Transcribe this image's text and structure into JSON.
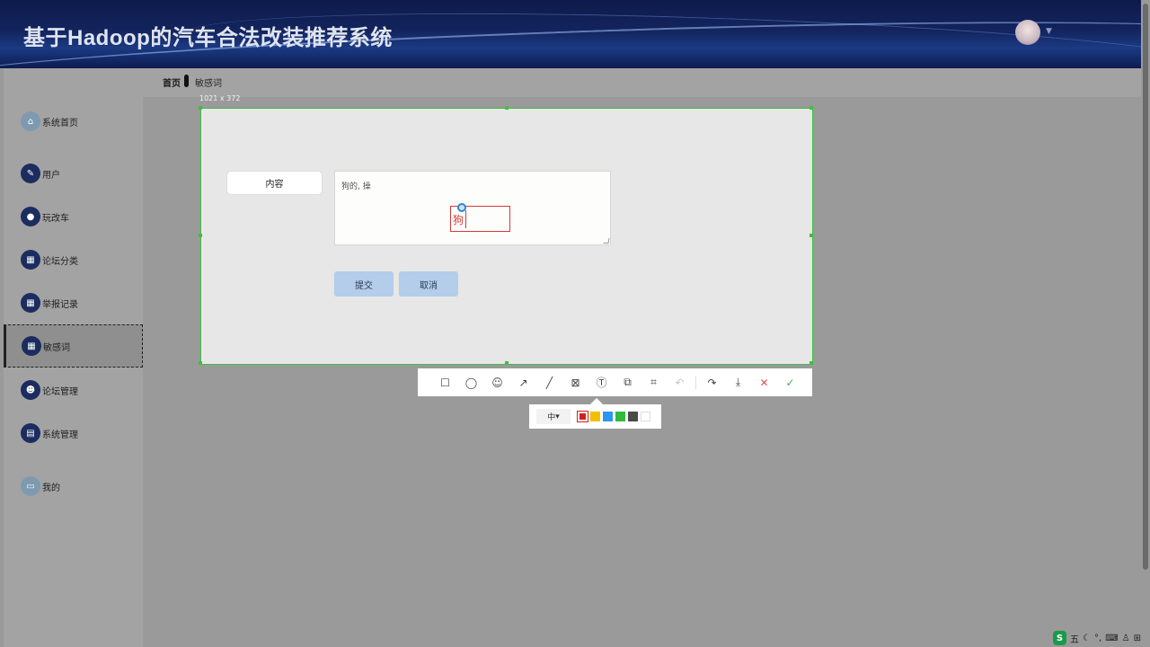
{
  "header": {
    "title": "基于Hadoop的汽车合法改装推荐系统"
  },
  "breadcrumb": {
    "home": "首页",
    "current": "敏感词"
  },
  "sidebar": {
    "items": [
      {
        "label": "系统首页",
        "icon": "home-icon"
      },
      {
        "label": "用户",
        "icon": "user-icon"
      },
      {
        "label": "玩改车",
        "icon": "location-pin-icon"
      },
      {
        "label": "论坛分类",
        "icon": "grid-icon"
      },
      {
        "label": "举报记录",
        "icon": "grid-icon"
      },
      {
        "label": "敏感词",
        "icon": "grid-icon",
        "active": true
      },
      {
        "label": "论坛管理",
        "icon": "person-icon"
      },
      {
        "label": "系统管理",
        "icon": "clipboard-icon"
      },
      {
        "label": "我的",
        "icon": "calendar-icon"
      }
    ]
  },
  "capture": {
    "size_label": "1021 x 372"
  },
  "form": {
    "field_label": "内容",
    "content_value": "狗的, 操",
    "annotation_text": "狗",
    "submit_label": "提交",
    "cancel_label": "取消"
  },
  "toolbar": {
    "tools": [
      "rectangle-icon",
      "ellipse-icon",
      "emoji-icon",
      "arrow-icon",
      "line-icon",
      "mosaic-icon",
      "text-icon",
      "copy-icon",
      "ocr-icon",
      "undo-icon",
      "share-icon",
      "download-icon",
      "close-icon",
      "confirm-icon"
    ]
  },
  "subbar": {
    "size_value": "中",
    "colors": [
      "#d01f1f",
      "#f3c000",
      "#2c97ef",
      "#2fbb3c",
      "#4a4a4a",
      "#ffffff"
    ],
    "selected_color": "#d01f1f"
  },
  "taskbar": {
    "ime_logo": "S",
    "ime_mode": "五"
  }
}
